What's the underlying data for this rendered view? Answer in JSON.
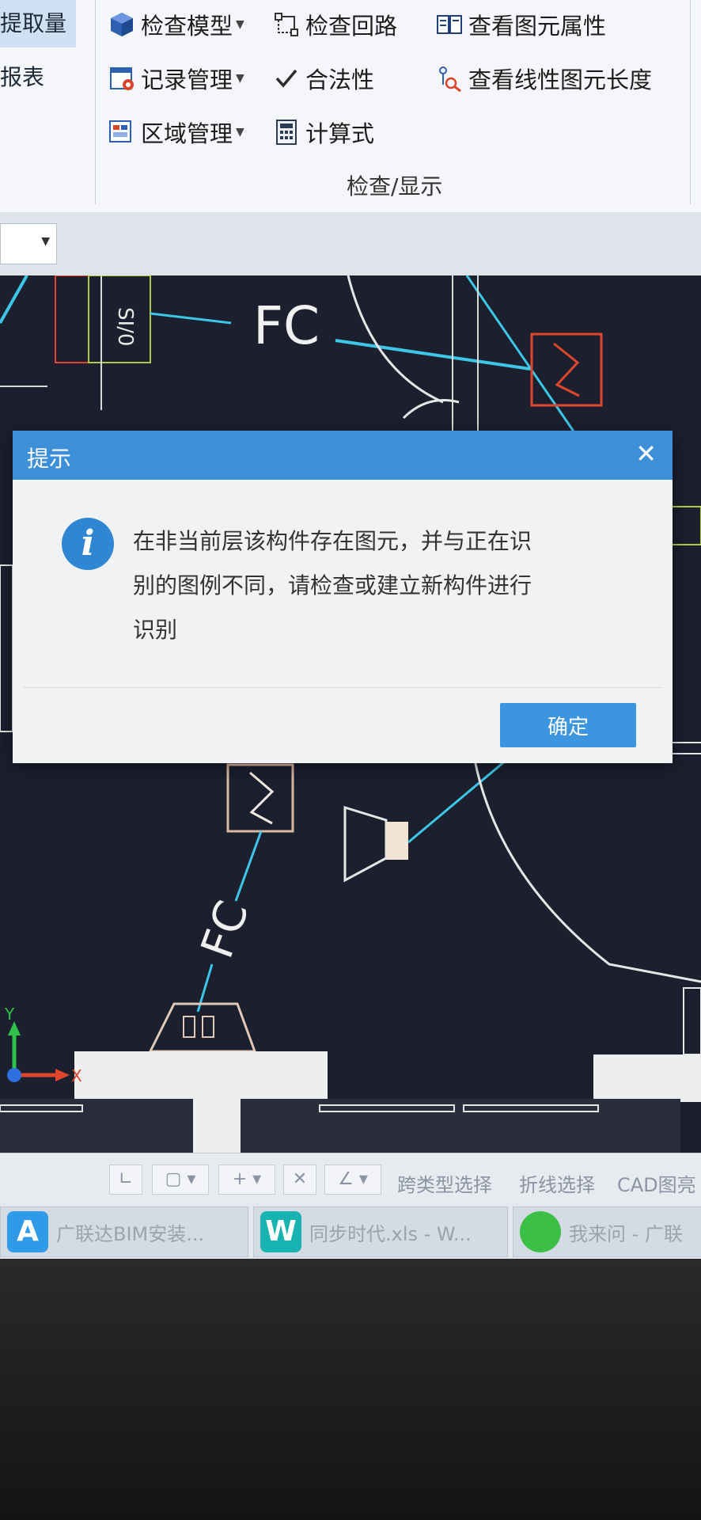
{
  "ribbon": {
    "left_tab_label": "提取量",
    "left_item_label": "报表",
    "buttons": {
      "check_model": "检查模型",
      "check_loop": "检查回路",
      "view_props": "查看图元属性",
      "record_mgmt": "记录管理",
      "legality": "合法性",
      "view_length": "查看线性图元长度",
      "region_mgmt": "区域管理",
      "formula": "计算式"
    },
    "group_label": "检查/显示"
  },
  "canvas": {
    "labels": {
      "fc_top": "FC",
      "fc_bottom": "FC",
      "tag_top": "SI/0",
      "axis_x": "X",
      "axis_y": "Y"
    }
  },
  "dialog": {
    "title": "提示",
    "close_glyph": "✕",
    "message_line1": "在非当前层该构件存在图元，并与正在识",
    "message_line2": "别的图例不同，请检查或建立新构件进行",
    "message_line3": "识别",
    "ok_label": "确定",
    "info_glyph": "i"
  },
  "statusbar": {
    "cross_type_select": "跨类型选择",
    "polyline_select": "折线选择",
    "cad_label": "CAD图亮"
  },
  "taskbar": {
    "items": [
      {
        "icon_text": "A",
        "label": "广联达BIM安装..."
      },
      {
        "icon_text": "W",
        "label": "同步时代.xls - W..."
      },
      {
        "icon_text": "",
        "label": "我来问 - 广联"
      }
    ]
  },
  "colors": {
    "title_blue": "#3d8fd8",
    "ok_blue": "#3d95e0",
    "canvas_bg": "#1b1f2e",
    "cad_cyan": "#3ec6e6",
    "cad_red": "#e0462c"
  },
  "icons": [
    "cube-icon",
    "loop-icon",
    "book-icon",
    "record-icon",
    "check-icon",
    "ruler-icon",
    "region-icon",
    "calculator-icon",
    "info-icon",
    "close-icon"
  ]
}
